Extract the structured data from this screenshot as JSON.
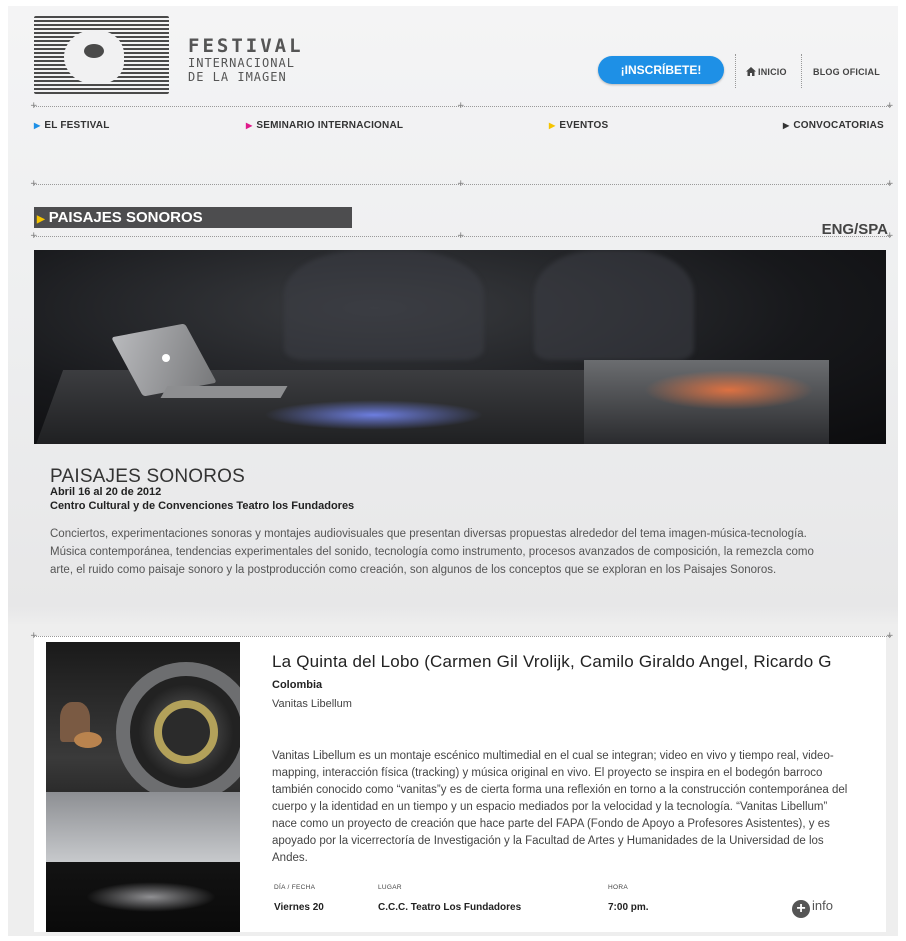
{
  "header": {
    "logo": {
      "line1": "FESTIVAL",
      "line2": "INTERNACIONAL",
      "line3": "DE LA IMAGEN"
    },
    "cta_label": "¡INSCRÍBETE!",
    "home_label": "INICIO",
    "blog_label": "BLOG OFICIAL"
  },
  "menu": [
    {
      "label": "EL FESTIVAL",
      "color": "#1e90e6"
    },
    {
      "label": "SEMINARIO INTERNACIONAL",
      "color": "#e0198a"
    },
    {
      "label": "EVENTOS",
      "color": "#f5c400"
    },
    {
      "label": "CONVOCATORIAS",
      "color": "#333333"
    }
  ],
  "section": {
    "title": "PAISAJES SONOROS",
    "lang": "ENG/SPA"
  },
  "event": {
    "title": "PAISAJES SONOROS",
    "dates": "Abril 16 al 20 de 2012",
    "venue": "Centro Cultural y de Convenciones Teatro los Fundadores",
    "description": "Conciertos, experimentaciones sonoras y montajes audiovisuales que presentan diversas propuestas alrededor del tema imagen-música-tecnología. Música contemporánea, tendencias experimentales del sonido, tecnología como instrumento, procesos avanzados de composición, la remezcla como arte, el ruido como paisaje sonoro y la postproducción como creación, son algunos de los conceptos que se exploran en los Paisajes Sonoros."
  },
  "card": {
    "title": "La Quinta del Lobo (Carmen Gil Vrolijk, Camilo Giraldo Angel, Ricardo G",
    "country": "Colombia",
    "work": "Vanitas Libellum",
    "description": "Vanitas Libellum es un montaje escénico multimedial en el cual se integran; video en vivo y tiempo real, video-mapping, interacción física (tracking) y música original en vivo. El proyecto se inspira en el bodegón barroco también conocido como “vanitas”y es de cierta forma una reflexión en torno a la construcción contemporánea del cuerpo y la identidad en un tiempo y un espacio mediados por la velocidad y la tecnología. “Vanitas Libellum” nace como un proyecto de creación que hace parte del FAPA (Fondo de Apoyo a Profesores Asistentes), y es apoyado por la vicerrectoría de Investigación y la Facultad de Artes y Humanidades de la Universidad de los Andes.",
    "date_label": "DÍA / FECHA",
    "date_value": "Viernes 20",
    "place_label": "LUGAR",
    "place_value": "C.C.C. Teatro Los Fundadores",
    "time_label": "HORA",
    "time_value": "7:00 pm.",
    "info_label": "info"
  }
}
